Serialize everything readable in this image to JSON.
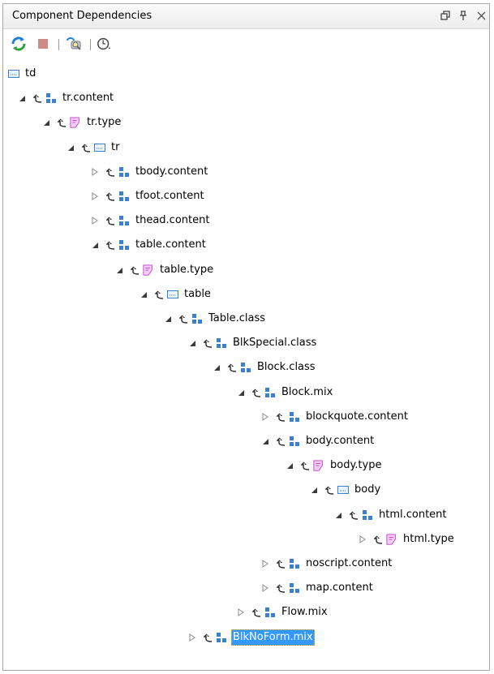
{
  "panel": {
    "title": "Component Dependencies",
    "restore_glyph": "⧉",
    "pin_glyph": "⊥",
    "close_glyph": "✕"
  },
  "toolbar": {
    "refresh_icon": "refresh-icon",
    "stop_icon": "stop-icon",
    "search_icon": "search-references-icon",
    "history_icon": "history-icon"
  },
  "colors": {
    "element_icon": "#3b7fd4",
    "type_icon": "#c23ec9",
    "selection": "#3399ff",
    "arrow": "#2b2b2b"
  },
  "tree": {
    "nodes": [
      {
        "label": "td",
        "kind": "element",
        "twisty": "none",
        "up": false,
        "depth": 0
      },
      {
        "label": "tr.content",
        "kind": "define",
        "twisty": "expanded",
        "up": true,
        "depth": 1
      },
      {
        "label": "tr.type",
        "kind": "type",
        "twisty": "expanded",
        "up": true,
        "depth": 2
      },
      {
        "label": "tr",
        "kind": "element",
        "twisty": "expanded",
        "up": true,
        "depth": 3
      },
      {
        "label": "tbody.content",
        "kind": "define",
        "twisty": "collapsed",
        "up": true,
        "depth": 4
      },
      {
        "label": "tfoot.content",
        "kind": "define",
        "twisty": "collapsed",
        "up": true,
        "depth": 4
      },
      {
        "label": "thead.content",
        "kind": "define",
        "twisty": "collapsed",
        "up": true,
        "depth": 4
      },
      {
        "label": "table.content",
        "kind": "define",
        "twisty": "expanded",
        "up": true,
        "depth": 4
      },
      {
        "label": "table.type",
        "kind": "type",
        "twisty": "expanded",
        "up": true,
        "depth": 5
      },
      {
        "label": "table",
        "kind": "element",
        "twisty": "expanded",
        "up": true,
        "depth": 6
      },
      {
        "label": "Table.class",
        "kind": "define",
        "twisty": "expanded",
        "up": true,
        "depth": 7
      },
      {
        "label": "BlkSpecial.class",
        "kind": "define",
        "twisty": "expanded",
        "up": true,
        "depth": 8
      },
      {
        "label": "Block.class",
        "kind": "define",
        "twisty": "expanded",
        "up": true,
        "depth": 9
      },
      {
        "label": "Block.mix",
        "kind": "define",
        "twisty": "expanded",
        "up": true,
        "depth": 10
      },
      {
        "label": "blockquote.content",
        "kind": "define",
        "twisty": "collapsed",
        "up": true,
        "depth": 11
      },
      {
        "label": "body.content",
        "kind": "define",
        "twisty": "expanded",
        "up": true,
        "depth": 11
      },
      {
        "label": "body.type",
        "kind": "type",
        "twisty": "expanded",
        "up": true,
        "depth": 12
      },
      {
        "label": "body",
        "kind": "element",
        "twisty": "expanded",
        "up": true,
        "depth": 13
      },
      {
        "label": "html.content",
        "kind": "define",
        "twisty": "expanded",
        "up": true,
        "depth": 14
      },
      {
        "label": "html.type",
        "kind": "type",
        "twisty": "collapsed",
        "up": true,
        "depth": 15
      },
      {
        "label": "noscript.content",
        "kind": "define",
        "twisty": "collapsed",
        "up": true,
        "depth": 11
      },
      {
        "label": "map.content",
        "kind": "define",
        "twisty": "collapsed",
        "up": true,
        "depth": 11
      },
      {
        "label": "Flow.mix",
        "kind": "define",
        "twisty": "collapsed",
        "up": true,
        "depth": 10
      },
      {
        "label": "BlkNoForm.mix",
        "kind": "define",
        "twisty": "collapsed",
        "up": true,
        "depth": 8,
        "selected": true
      }
    ]
  }
}
